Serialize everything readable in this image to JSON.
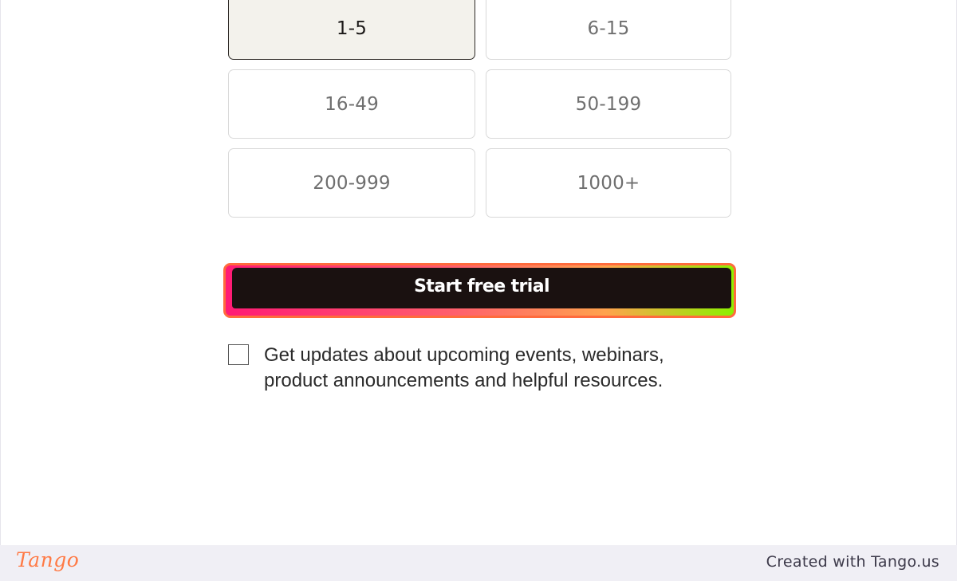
{
  "company_size": {
    "options": [
      {
        "label": "1-5",
        "selected": true
      },
      {
        "label": "6-15",
        "selected": false
      },
      {
        "label": "16-49",
        "selected": false
      },
      {
        "label": "50-199",
        "selected": false
      },
      {
        "label": "200-999",
        "selected": false
      },
      {
        "label": "1000+",
        "selected": false
      }
    ]
  },
  "cta": {
    "label": "Start free trial",
    "highlight_color": "#ff6b3d",
    "button_color": "#1a1110"
  },
  "consent": {
    "checked": false,
    "text": "Get updates about upcoming events, webinars, product announcements and helpful resources."
  },
  "footer": {
    "logo_text": "Tango",
    "credit": "Created with Tango.us",
    "logo_color": "#ff7a45"
  }
}
